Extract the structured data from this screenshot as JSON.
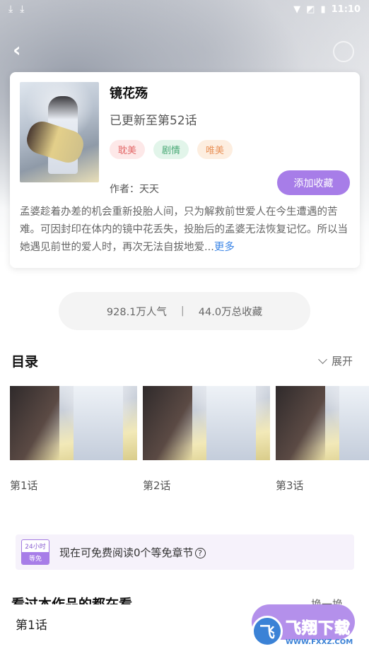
{
  "status_bar": {
    "time": "11:10",
    "left_icons": [
      "download-icon",
      "download-icon"
    ],
    "right_icons": [
      "wifi-icon",
      "signal-icon",
      "battery-icon"
    ]
  },
  "comic": {
    "title": "镜花殇",
    "update_status": "已更新至第52话",
    "tags": [
      "耽美",
      "剧情",
      "唯美"
    ],
    "author": "作者：天天",
    "favorite_button": "添加收藏",
    "description": "孟婆趁着办差的机会重新投胎人间，只为解救前世爱人在今生遭遇的苦难。可因封印在体内的镜中花丢失，投胎后的孟婆无法恢复记忆。所以当她遇见前世的爱人时，再次无法自拔地爱...",
    "more_link": "更多"
  },
  "stats": {
    "popularity": "928.1万人气",
    "separator": "|",
    "favorites": "44.0万总收藏"
  },
  "catalog": {
    "title": "目录",
    "expand_label": "展开",
    "episodes": [
      {
        "label": "第1话"
      },
      {
        "label": "第2话"
      },
      {
        "label": "第3话"
      }
    ]
  },
  "free_banner": {
    "badge_top": "24小时",
    "badge_bottom": "等免",
    "text": "现在可免费阅读0个等免章节",
    "help_icon": "?"
  },
  "next_section": {
    "title": "看过本作品的都在看",
    "action": "换一换"
  },
  "bottom_bar": {
    "current_chapter": "第1话"
  },
  "watermark": {
    "logo_char": "飞",
    "main": "飞翔下载",
    "sub": "WWW.FXXZ.COM"
  },
  "colors": {
    "accent": "#a77de8",
    "link": "#3a84e6"
  }
}
